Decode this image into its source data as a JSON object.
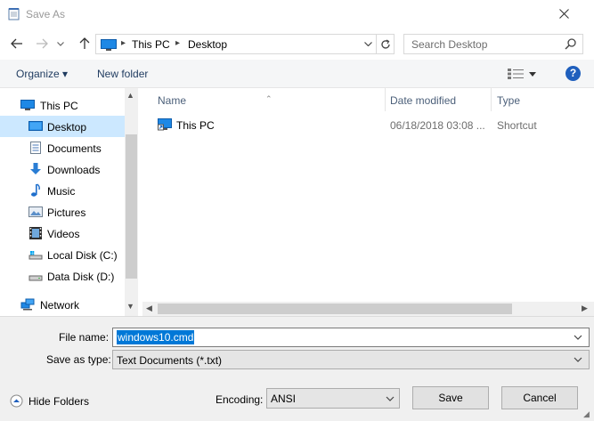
{
  "window": {
    "title": "Save As"
  },
  "address": {
    "segments": [
      "This PC",
      "Desktop"
    ],
    "search_placeholder": "Search Desktop"
  },
  "commands": {
    "organize": "Organize ▾",
    "new_folder": "New folder",
    "help": "?"
  },
  "nav": {
    "items": [
      {
        "label": "This PC",
        "icon": "pc-icon",
        "selected": false
      },
      {
        "label": "Desktop",
        "icon": "desktop-icon",
        "selected": true
      },
      {
        "label": "Documents",
        "icon": "documents-icon",
        "selected": false
      },
      {
        "label": "Downloads",
        "icon": "downloads-icon",
        "selected": false
      },
      {
        "label": "Music",
        "icon": "music-icon",
        "selected": false
      },
      {
        "label": "Pictures",
        "icon": "pictures-icon",
        "selected": false
      },
      {
        "label": "Videos",
        "icon": "videos-icon",
        "selected": false
      },
      {
        "label": "Local Disk (C:)",
        "icon": "drive-icon",
        "selected": false
      },
      {
        "label": "Data Disk (D:)",
        "icon": "drive-icon",
        "selected": false
      },
      {
        "label": "Network",
        "icon": "network-icon",
        "selected": false
      }
    ]
  },
  "columns": {
    "name": "Name",
    "date": "Date modified",
    "type": "Type"
  },
  "files": [
    {
      "name": "This PC",
      "date": "06/18/2018 03:08 ...",
      "type": "Shortcut"
    }
  ],
  "form": {
    "file_name_label": "File name:",
    "file_name_value": "windows10.cmd",
    "save_type_label": "Save as type:",
    "save_type_value": "Text Documents (*.txt)",
    "encoding_label": "Encoding:",
    "encoding_value": "ANSI",
    "hide_folders": "Hide Folders",
    "save": "Save",
    "cancel": "Cancel"
  },
  "colors": {
    "accent": "#0078d7",
    "selection": "#cce8ff"
  }
}
